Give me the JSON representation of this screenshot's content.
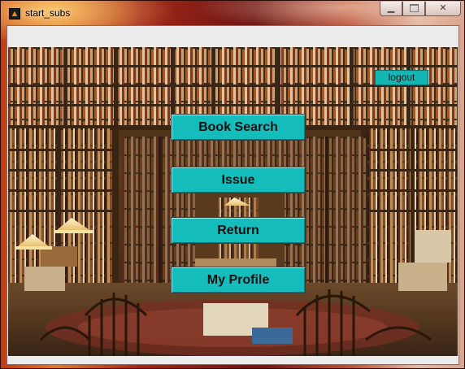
{
  "window": {
    "title": "start_subs",
    "app_icon": "matlab-icon",
    "controls": {
      "minimize_glyph": "▁",
      "close_glyph": "✕"
    }
  },
  "buttons": {
    "logout": "logout",
    "book_search": "Book Search",
    "issue": "Issue",
    "return": "Return",
    "my_profile": "My Profile"
  },
  "colors": {
    "button_bg": "#14bcbb",
    "logout_bg": "#12b7b4",
    "client_bg": "#ececec"
  }
}
